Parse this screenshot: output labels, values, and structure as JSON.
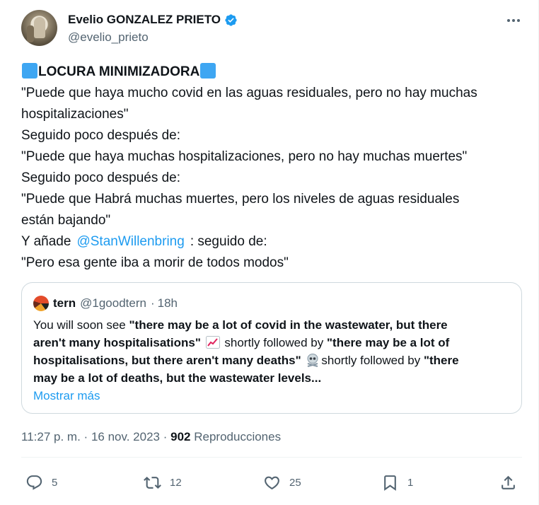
{
  "author": {
    "name": "Evelio GONZALEZ PRIETO",
    "handle": "@evelio_prieto"
  },
  "tweet": {
    "headline": "LOCURA MINIMIZADORA",
    "lines": [
      "\"Puede que haya mucho covid en las aguas residuales, pero no hay muchas",
      "hospitalizaciones\"",
      "Seguido poco después de:",
      "\"Puede que haya muchas hospitalizaciones, pero no hay muchas muertes\"",
      "Seguido poco después de:",
      "\"Puede que Habrá muchas muertes, pero los niveles de aguas residuales",
      "están bajando\""
    ],
    "mention_prefix": "Y añade",
    "mention": "@StanWillenbring",
    "mention_suffix": ": seguido de:",
    "last_line": "\"Pero esa gente iba a morir de todos modos\""
  },
  "quote": {
    "name": "tern",
    "handle": "@1goodtern",
    "separator": "·",
    "time": "18h",
    "text": {
      "l1_plain": "You will soon see ",
      "l1_bold": "\"there may be a lot of covid in the wastewater, but there",
      "l2_bold": "aren't many hospitalisations\"",
      "l2_plain": " shortly followed by ",
      "l2_bold2": "\"there may be a lot of",
      "l3_bold": "hospitalisations, but there aren't many deaths\"",
      "l3_plain": "shortly followed by ",
      "l3_bold2": "\"there",
      "l4_bold": "may be a lot of deaths, but the wastewater levels..."
    },
    "show_more": "Mostrar más"
  },
  "meta": {
    "time": "11:27 p. m.",
    "dot": "·",
    "date": "16 nov. 2023",
    "views_count": "902",
    "views_label": "Reproducciones"
  },
  "actions": {
    "replies": "5",
    "reposts": "12",
    "likes": "25",
    "bookmarks": "1"
  },
  "colors": {
    "accent": "#1d9bf0",
    "muted": "#536471",
    "square_emoji": "#3ea6f2"
  }
}
